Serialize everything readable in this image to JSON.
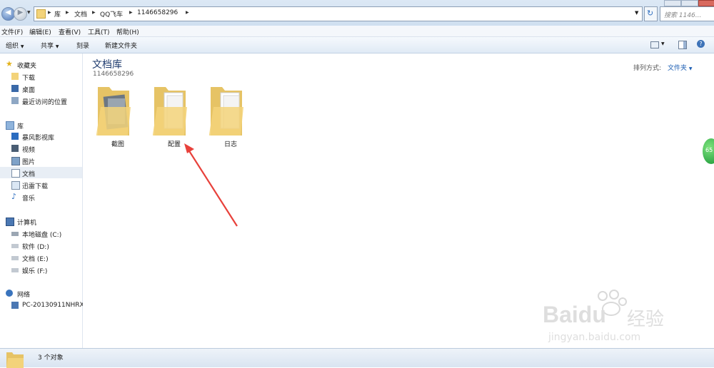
{
  "address": {
    "crumbs": [
      "库",
      "文档",
      "QQ飞车",
      "1146658296"
    ],
    "search_placeholder": "搜索 1146..."
  },
  "menu": [
    "文件(F)",
    "编辑(E)",
    "查看(V)",
    "工具(T)",
    "帮助(H)"
  ],
  "toolbar": {
    "organize": "组织",
    "share": "共享",
    "burn": "刻录",
    "new_folder": "新建文件夹"
  },
  "sidebar": {
    "favorites": {
      "label": "收藏夹",
      "items": [
        "下载",
        "桌面",
        "最近访问的位置"
      ]
    },
    "libraries": {
      "label": "库",
      "items": [
        "暴风影视库",
        "视频",
        "图片",
        "文档",
        "迅雷下载",
        "音乐"
      ]
    },
    "computer": {
      "label": "计算机",
      "items": [
        "本地磁盘 (C:)",
        "软件 (D:)",
        "文档 (E:)",
        "娱乐 (F:)"
      ]
    },
    "network": {
      "label": "网络",
      "items": [
        "PC-20130911NHRX"
      ]
    }
  },
  "content": {
    "title": "文档库",
    "subtitle": "1146658296",
    "sort_label": "排列方式:",
    "sort_value": "文件夹",
    "folders": [
      "截图",
      "配置",
      "日志"
    ]
  },
  "status": {
    "text": "3 个对象"
  },
  "watermark": {
    "brand": "Bai",
    "brand2": "du",
    "cn": "经验",
    "url": "jingyan.baidu.com"
  },
  "badge": {
    "text": "65"
  },
  "colors": {
    "arrow": "#e8413b",
    "folder": "#f3d37a",
    "accent": "#1e5fb4"
  }
}
